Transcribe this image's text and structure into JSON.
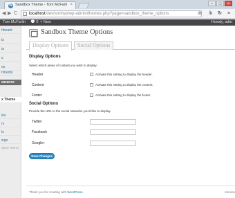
{
  "browser": {
    "tab_title": "Sandbox Theme - Tom McFarli",
    "tab_close": "×",
    "url_host": "localhost",
    "url_path": "/dev/tom/wp/wp-admin/themes.php?page=sandbox_theme_options",
    "back": "◀",
    "forward": "▶",
    "reload": "C",
    "star": "☆",
    "ext1": "k",
    "ext2": "↻",
    "menu": "≡",
    "min": "–",
    "max": "□",
    "close": "×"
  },
  "adminbar": {
    "site_name": "Tom McFarlin",
    "comments": "0",
    "new_label": "+ New",
    "howdy": "Howdy, adm"
  },
  "sidebar": {
    "items": [
      {
        "label": "hboard"
      },
      {
        "label": "ts"
      },
      {
        "label": "ia"
      },
      {
        "label": "s"
      },
      {
        "label": "es"
      },
      {
        "label": "nments"
      },
      {
        "label": "earance"
      },
      {
        "label": "x Theme"
      },
      {
        "label": "ins"
      },
      {
        "label": "rs"
      },
      {
        "label": "ls"
      },
      {
        "label": "ings"
      },
      {
        "label": "apse menu"
      }
    ]
  },
  "main": {
    "page_title": "Sandbox Theme Options",
    "tabs": [
      {
        "label": "Display Options"
      },
      {
        "label": "Social Options"
      }
    ],
    "display": {
      "heading": "Display Options",
      "description": "Select which areas of content you wish to display.",
      "rows": [
        {
          "label": "Header",
          "checkbox_label": "Activate this setting to display the header."
        },
        {
          "label": "Content",
          "checkbox_label": "Activate this setting to display the content."
        },
        {
          "label": "Footer",
          "checkbox_label": "Activate this setting to display the footer."
        }
      ]
    },
    "social": {
      "heading": "Social Options",
      "description": "Provide the URL to the social networks you'd like to display.",
      "rows": [
        {
          "label": "Twitter",
          "value": ""
        },
        {
          "label": "Facebook",
          "value": ""
        },
        {
          "label": "Google+",
          "value": ""
        }
      ]
    },
    "save_label": "Save Changes",
    "footer_prefix": "Thank you for creating with ",
    "footer_link": "WordPress",
    "footer_suffix": ".",
    "version": "Version"
  }
}
